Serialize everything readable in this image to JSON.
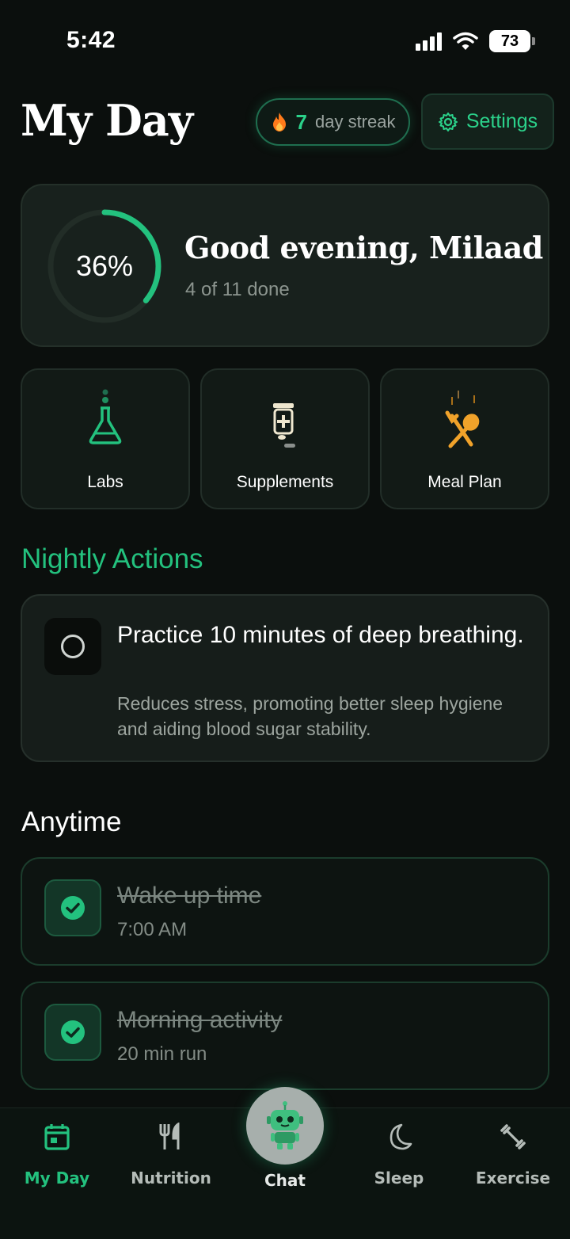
{
  "status_bar": {
    "time": "5:42",
    "battery": "73"
  },
  "header": {
    "title": "My Day",
    "streak_count": "7",
    "streak_label": "day streak",
    "settings_label": "Settings"
  },
  "greeting": {
    "progress_percent": 36,
    "progress_text": "36%",
    "title": "Good evening, Milaad",
    "subtitle": "4 of 11 done"
  },
  "tiles": [
    {
      "label": "Labs",
      "icon": "flask-icon"
    },
    {
      "label": "Supplements",
      "icon": "pill-bottle-icon"
    },
    {
      "label": "Meal Plan",
      "icon": "fork-spoon-icon"
    }
  ],
  "nightly": {
    "section_title": "Nightly Actions",
    "items": [
      {
        "title": "Practice 10 minutes of deep breathing.",
        "description": "Reduces stress, promoting better sleep hygiene and aiding blood sugar stability.",
        "done": false
      }
    ]
  },
  "anytime": {
    "section_title": "Anytime",
    "items": [
      {
        "title": "Wake up time",
        "subtitle": "7:00 AM",
        "done": true
      },
      {
        "title": "Morning activity",
        "subtitle": "20 min run",
        "done": true
      }
    ]
  },
  "nav": {
    "items": [
      {
        "label": "My Day",
        "icon": "calendar-icon",
        "active": true
      },
      {
        "label": "Nutrition",
        "icon": "fork-knife-icon",
        "active": false
      },
      {
        "label": "Chat",
        "icon": "robot-icon",
        "active": false
      },
      {
        "label": "Sleep",
        "icon": "moon-icon",
        "active": false
      },
      {
        "label": "Exercise",
        "icon": "dumbbell-icon",
        "active": false
      }
    ]
  },
  "colors": {
    "accent": "#23c17e",
    "background": "#0b0f0d",
    "streak_flame": "#ff7a1a",
    "meal_plan_icon": "#f0a22a"
  }
}
